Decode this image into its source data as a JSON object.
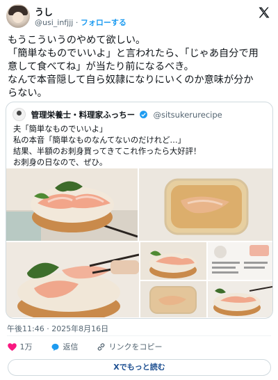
{
  "author": {
    "display_name": "うし",
    "handle": "@usi_infjjj",
    "separator": "·",
    "follow_label": "フォローする"
  },
  "tweet_lines": [
    "もうこういうのやめて欲しい。",
    "「簡単なものでいいよ」と言われたら、「じゃあ自分で用",
    "意して食べてね」が当たり前になるべき。",
    "なんで本音隠して自ら奴隷になりにいくのか意味が分か",
    "らない。"
  ],
  "quote": {
    "display_name": "管理栄養士・料理家ふっちー",
    "handle": "@sitsukerurecipe",
    "lines": [
      "夫「簡単なものでいいよ」",
      "私の本音「簡単なものなんてないのだけれど…」",
      "結果、半額のお刺身買ってきてこれ作ったら大好評！",
      "お刺身の日なので、ぜひ。"
    ]
  },
  "timestamp": "午後11:46 · 2025年8月16日",
  "actions": {
    "like_count": "1万",
    "reply_label": "返信",
    "copy_link_label": "リンクをコピー"
  },
  "read_more_label": "Xでもっと読む",
  "colors": {
    "link_blue": "#1d9bf0",
    "like_red": "#f91880",
    "muted_text": "#536471"
  },
  "icons": [
    "x-logo-icon",
    "heart-icon",
    "reply-icon",
    "link-icon",
    "verified-badge-icon"
  ]
}
